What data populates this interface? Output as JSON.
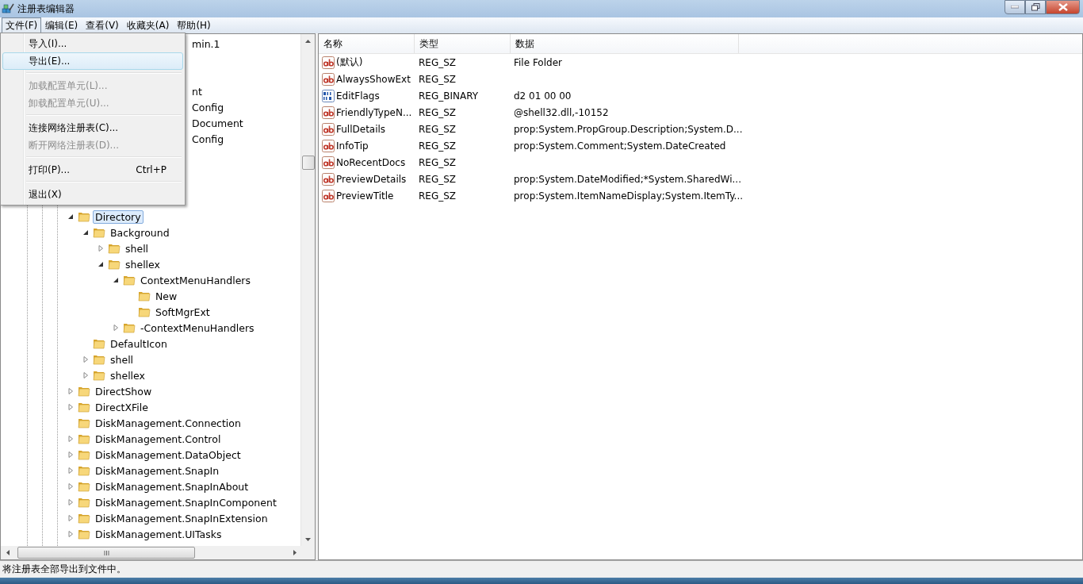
{
  "window": {
    "title": "注册表编辑器"
  },
  "menubar": [
    {
      "label": "文件(F)",
      "selected": true
    },
    {
      "label": "编辑(E)",
      "selected": false
    },
    {
      "label": "查看(V)",
      "selected": false
    },
    {
      "label": "收藏夹(A)",
      "selected": false
    },
    {
      "label": "帮助(H)",
      "selected": false
    }
  ],
  "file_menu": [
    {
      "kind": "item",
      "label": "导入(I)...",
      "disabled": false,
      "selected": false
    },
    {
      "kind": "item",
      "label": "导出(E)...",
      "disabled": false,
      "selected": true
    },
    {
      "kind": "separator"
    },
    {
      "kind": "item",
      "label": "加载配置单元(L)...",
      "disabled": true,
      "selected": false
    },
    {
      "kind": "item",
      "label": "卸载配置单元(U)...",
      "disabled": true,
      "selected": false
    },
    {
      "kind": "separator"
    },
    {
      "kind": "item",
      "label": "连接网络注册表(C)...",
      "disabled": false,
      "selected": false
    },
    {
      "kind": "item",
      "label": "断开网络注册表(D)...",
      "disabled": true,
      "selected": false
    },
    {
      "kind": "separator"
    },
    {
      "kind": "item",
      "label": "打印(P)...",
      "shortcut": "Ctrl+P",
      "disabled": false,
      "selected": false
    },
    {
      "kind": "separator"
    },
    {
      "kind": "item",
      "label": "退出(X)",
      "disabled": false,
      "selected": false
    }
  ],
  "tree": {
    "covered_fragments": [
      "min.1",
      "nt",
      "Config",
      "Document",
      "Config"
    ],
    "items": [
      {
        "label": "Directory",
        "expanded": true,
        "selected": true,
        "children": [
          {
            "label": "Background",
            "expanded": true,
            "selected": false,
            "children": [
              {
                "label": "shell",
                "has_children": true,
                "expanded": false,
                "selected": false
              },
              {
                "label": "shellex",
                "expanded": true,
                "selected": false,
                "children": [
                  {
                    "label": "ContextMenuHandlers",
                    "expanded": true,
                    "selected": false,
                    "children": [
                      {
                        "label": "New",
                        "has_children": false,
                        "expanded": false,
                        "selected": false
                      },
                      {
                        "label": "SoftMgrExt",
                        "has_children": false,
                        "expanded": false,
                        "selected": false
                      }
                    ]
                  },
                  {
                    "label": "-ContextMenuHandlers",
                    "has_children": true,
                    "expanded": false,
                    "selected": false
                  }
                ]
              }
            ]
          },
          {
            "label": "DefaultIcon",
            "has_children": false,
            "expanded": false,
            "selected": false
          },
          {
            "label": "shell",
            "has_children": true,
            "expanded": false,
            "selected": false
          },
          {
            "label": "shellex",
            "has_children": true,
            "expanded": false,
            "selected": false
          }
        ]
      },
      {
        "label": "DirectShow",
        "has_children": true,
        "expanded": false,
        "selected": false
      },
      {
        "label": "DirectXFile",
        "has_children": true,
        "expanded": false,
        "selected": false
      },
      {
        "label": "DiskManagement.Connection",
        "has_children": false,
        "expanded": false,
        "selected": false
      },
      {
        "label": "DiskManagement.Control",
        "has_children": true,
        "expanded": false,
        "selected": false
      },
      {
        "label": "DiskManagement.DataObject",
        "has_children": true,
        "expanded": false,
        "selected": false
      },
      {
        "label": "DiskManagement.SnapIn",
        "has_children": true,
        "expanded": false,
        "selected": false
      },
      {
        "label": "DiskManagement.SnapInAbout",
        "has_children": true,
        "expanded": false,
        "selected": false
      },
      {
        "label": "DiskManagement.SnapInComponent",
        "has_children": true,
        "expanded": false,
        "selected": false
      },
      {
        "label": "DiskManagement.SnapInExtension",
        "has_children": true,
        "expanded": false,
        "selected": false
      },
      {
        "label": "DiskManagement.UITasks",
        "has_children": true,
        "expanded": false,
        "selected": false
      }
    ]
  },
  "values": {
    "columns": [
      "名称",
      "类型",
      "数据"
    ],
    "rows": [
      {
        "kind": "string",
        "name": "(默认)",
        "type": "REG_SZ",
        "data": "File Folder"
      },
      {
        "kind": "string",
        "name": "AlwaysShowExt",
        "type": "REG_SZ"
      },
      {
        "kind": "binary",
        "name": "EditFlags",
        "type": "REG_BINARY",
        "data": "d2 01 00 00"
      },
      {
        "kind": "string",
        "name": "FriendlyTypeN...",
        "type": "REG_SZ",
        "data": "@shell32.dll,-10152"
      },
      {
        "kind": "string",
        "name": "FullDetails",
        "type": "REG_SZ",
        "data": "prop:System.PropGroup.Description;System.D..."
      },
      {
        "kind": "string",
        "name": "InfoTip",
        "type": "REG_SZ",
        "data": "prop:System.Comment;System.DateCreated"
      },
      {
        "kind": "string",
        "name": "NoRecentDocs",
        "type": "REG_SZ"
      },
      {
        "kind": "string",
        "name": "PreviewDetails",
        "type": "REG_SZ",
        "data": "prop:System.DateModified;*System.SharedWi..."
      },
      {
        "kind": "string",
        "name": "PreviewTitle",
        "type": "REG_SZ",
        "data": "prop:System.ItemNameDisplay;System.ItemTy..."
      }
    ]
  },
  "status_bar": {
    "text": "将注册表全部导出到文件中。"
  }
}
